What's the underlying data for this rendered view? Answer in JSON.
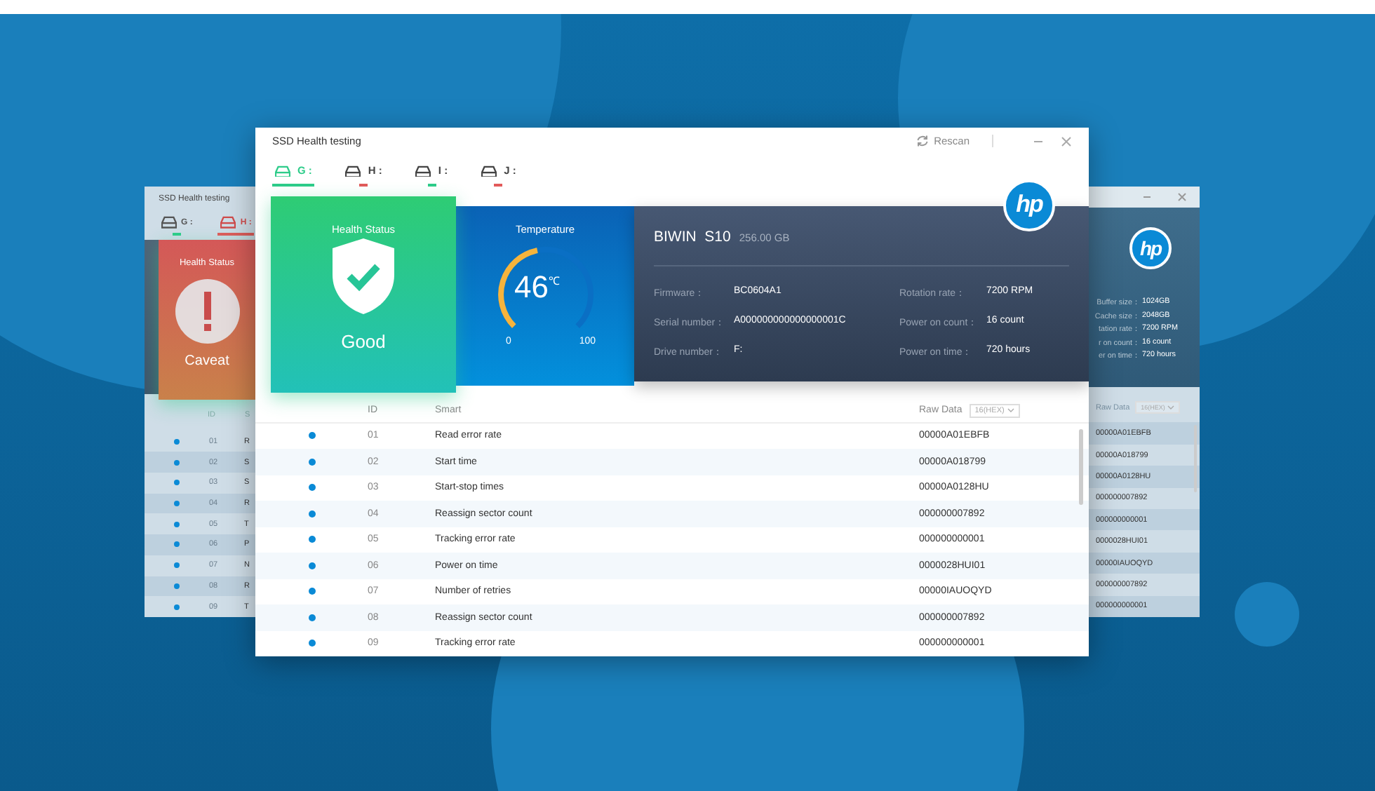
{
  "back_window_left": {
    "title": "SSD Health testing",
    "tabs": [
      {
        "label": "G :",
        "selected": false,
        "color": "#2ecc8a"
      },
      {
        "label": "H :",
        "selected": true,
        "color": "#e25a5a"
      }
    ],
    "health": {
      "kind": "caveat",
      "title": "Health Status",
      "status": "Caveat"
    },
    "table": {
      "columns": [
        "ID",
        "S"
      ],
      "rows": [
        {
          "id": "01",
          "smart": "R"
        },
        {
          "id": "02",
          "smart": "S"
        },
        {
          "id": "03",
          "smart": "S"
        },
        {
          "id": "04",
          "smart": "R"
        },
        {
          "id": "05",
          "smart": "T"
        },
        {
          "id": "06",
          "smart": "P"
        },
        {
          "id": "07",
          "smart": "N"
        },
        {
          "id": "08",
          "smart": "R"
        },
        {
          "id": "09",
          "smart": "T"
        }
      ]
    }
  },
  "back_window_right": {
    "logo": "hp",
    "fields": [
      {
        "label": "Buffer size：",
        "value": "1024GB"
      },
      {
        "label": "Cache size：",
        "value": "2048GB"
      },
      {
        "label": "tation rate：",
        "value": "7200 RPM"
      },
      {
        "label": "r on count：",
        "value": "16 count"
      },
      {
        "label": "er on time：",
        "value": "720 hours"
      }
    ],
    "table": {
      "column": "Raw Data",
      "format": "16(HEX)",
      "rows": [
        "00000A01EBFB",
        "00000A018799",
        "00000A0128HU",
        "000000007892",
        "000000000001",
        "0000028HUI01",
        "00000IAUOQYD",
        "000000007892",
        "000000000001"
      ]
    }
  },
  "main_window": {
    "title": "SSD Health testing",
    "rescan": "Rescan",
    "tabs": [
      {
        "label": "G :",
        "selected": true,
        "color": "#2ecc8a"
      },
      {
        "label": "H :",
        "selected": false,
        "color": "#e25a5a"
      },
      {
        "label": "I :",
        "selected": false,
        "color": "#2ecc8a"
      },
      {
        "label": "J :",
        "selected": false,
        "color": "#e25a5a"
      }
    ],
    "health": {
      "kind": "good",
      "title": "Health Status",
      "status": "Good"
    },
    "temperature": {
      "title": "Temperature",
      "value": "46",
      "unit": "℃",
      "level": 0.46,
      "min": "0",
      "max": "100"
    },
    "logo": "hp",
    "drive": {
      "name": "BIWIN  S10",
      "capacity": "256.00 GB",
      "fields": [
        {
          "label": "Firmware：",
          "value": "BC0604A1"
        },
        {
          "label": "Rotation rate：",
          "value": "7200 RPM"
        },
        {
          "label": "Serial number：",
          "value": "A000000000000000001C"
        },
        {
          "label": "Power on count：",
          "value": "16 count"
        },
        {
          "label": "Drive number：",
          "value": "F:"
        },
        {
          "label": "Power on time：",
          "value": "720 hours"
        }
      ]
    },
    "table": {
      "columns": {
        "id": "ID",
        "smart": "Smart",
        "raw": "Raw Data"
      },
      "format": "16(HEX)",
      "rows": [
        {
          "id": "01",
          "smart": "Read error rate",
          "raw": "00000A01EBFB"
        },
        {
          "id": "02",
          "smart": "Start time",
          "raw": "00000A018799"
        },
        {
          "id": "03",
          "smart": "Start-stop times",
          "raw": "00000A0128HU"
        },
        {
          "id": "04",
          "smart": "Reassign sector count",
          "raw": "000000007892"
        },
        {
          "id": "05",
          "smart": "Tracking error rate",
          "raw": "000000000001"
        },
        {
          "id": "06",
          "smart": "Power on time",
          "raw": "0000028HUI01"
        },
        {
          "id": "07",
          "smart": "Number of retries",
          "raw": "00000IAUOQYD"
        },
        {
          "id": "08",
          "smart": "Reassign sector count",
          "raw": "000000007892"
        },
        {
          "id": "09",
          "smart": "Tracking error rate",
          "raw": "000000000001"
        }
      ]
    }
  }
}
